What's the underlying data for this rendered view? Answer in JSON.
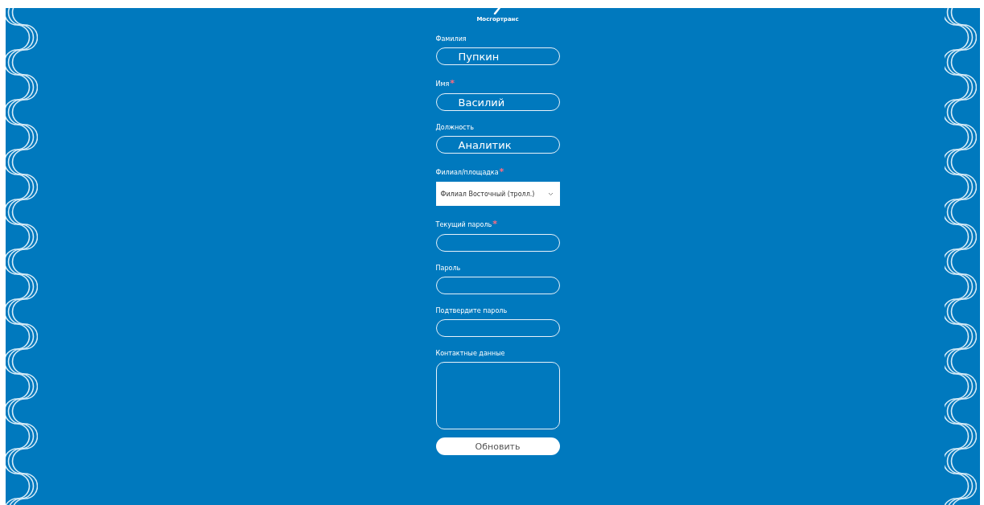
{
  "logo": {
    "caption": "Мосгортранс"
  },
  "required_mark": "*",
  "fields": [
    {
      "kind": "text",
      "label": "Фамилия",
      "required": false,
      "value": "Пупкин"
    },
    {
      "kind": "text",
      "label": "Имя",
      "required": true,
      "value": "Василий"
    },
    {
      "kind": "text",
      "label": "Должность",
      "required": false,
      "value": "Аналитик"
    },
    {
      "kind": "select",
      "label": "Филиал/площадка",
      "required": true,
      "value": "Филиал Восточный (тролл.)"
    },
    {
      "kind": "text",
      "label": "Текущий пароль",
      "required": true
    },
    {
      "kind": "text",
      "label": "Пароль",
      "required": false
    },
    {
      "kind": "text",
      "label": "Подтвердите пароль",
      "required": false
    },
    {
      "kind": "textarea",
      "label": "Контактные данные",
      "required": false
    }
  ],
  "submit": {
    "label": "Обновить"
  }
}
